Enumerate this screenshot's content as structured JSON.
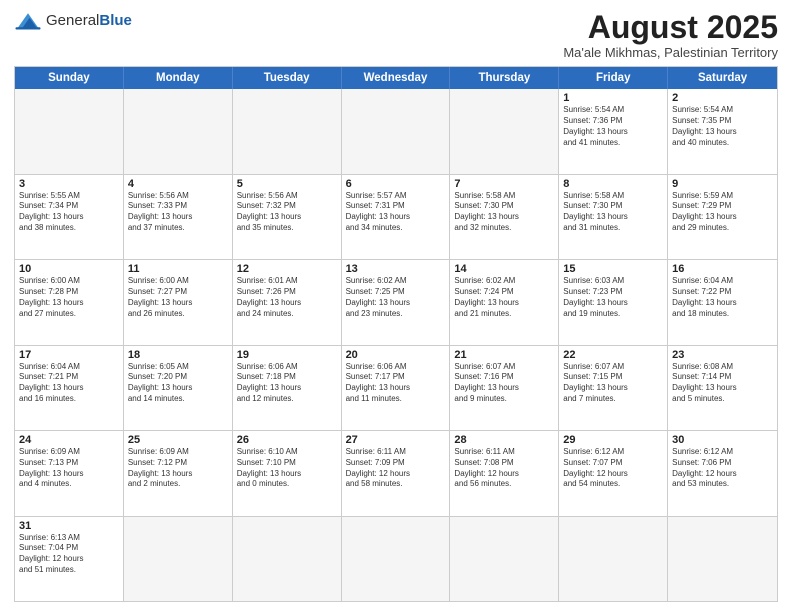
{
  "header": {
    "logo_general": "General",
    "logo_blue": "Blue",
    "title": "August 2025",
    "location": "Ma'ale Mikhmas, Palestinian Territory"
  },
  "calendar": {
    "days_of_week": [
      "Sunday",
      "Monday",
      "Tuesday",
      "Wednesday",
      "Thursday",
      "Friday",
      "Saturday"
    ],
    "rows": [
      [
        {
          "num": "",
          "info": ""
        },
        {
          "num": "",
          "info": ""
        },
        {
          "num": "",
          "info": ""
        },
        {
          "num": "",
          "info": ""
        },
        {
          "num": "",
          "info": ""
        },
        {
          "num": "1",
          "info": "Sunrise: 5:54 AM\nSunset: 7:36 PM\nDaylight: 13 hours\nand 41 minutes."
        },
        {
          "num": "2",
          "info": "Sunrise: 5:54 AM\nSunset: 7:35 PM\nDaylight: 13 hours\nand 40 minutes."
        }
      ],
      [
        {
          "num": "3",
          "info": "Sunrise: 5:55 AM\nSunset: 7:34 PM\nDaylight: 13 hours\nand 38 minutes."
        },
        {
          "num": "4",
          "info": "Sunrise: 5:56 AM\nSunset: 7:33 PM\nDaylight: 13 hours\nand 37 minutes."
        },
        {
          "num": "5",
          "info": "Sunrise: 5:56 AM\nSunset: 7:32 PM\nDaylight: 13 hours\nand 35 minutes."
        },
        {
          "num": "6",
          "info": "Sunrise: 5:57 AM\nSunset: 7:31 PM\nDaylight: 13 hours\nand 34 minutes."
        },
        {
          "num": "7",
          "info": "Sunrise: 5:58 AM\nSunset: 7:30 PM\nDaylight: 13 hours\nand 32 minutes."
        },
        {
          "num": "8",
          "info": "Sunrise: 5:58 AM\nSunset: 7:30 PM\nDaylight: 13 hours\nand 31 minutes."
        },
        {
          "num": "9",
          "info": "Sunrise: 5:59 AM\nSunset: 7:29 PM\nDaylight: 13 hours\nand 29 minutes."
        }
      ],
      [
        {
          "num": "10",
          "info": "Sunrise: 6:00 AM\nSunset: 7:28 PM\nDaylight: 13 hours\nand 27 minutes."
        },
        {
          "num": "11",
          "info": "Sunrise: 6:00 AM\nSunset: 7:27 PM\nDaylight: 13 hours\nand 26 minutes."
        },
        {
          "num": "12",
          "info": "Sunrise: 6:01 AM\nSunset: 7:26 PM\nDaylight: 13 hours\nand 24 minutes."
        },
        {
          "num": "13",
          "info": "Sunrise: 6:02 AM\nSunset: 7:25 PM\nDaylight: 13 hours\nand 23 minutes."
        },
        {
          "num": "14",
          "info": "Sunrise: 6:02 AM\nSunset: 7:24 PM\nDaylight: 13 hours\nand 21 minutes."
        },
        {
          "num": "15",
          "info": "Sunrise: 6:03 AM\nSunset: 7:23 PM\nDaylight: 13 hours\nand 19 minutes."
        },
        {
          "num": "16",
          "info": "Sunrise: 6:04 AM\nSunset: 7:22 PM\nDaylight: 13 hours\nand 18 minutes."
        }
      ],
      [
        {
          "num": "17",
          "info": "Sunrise: 6:04 AM\nSunset: 7:21 PM\nDaylight: 13 hours\nand 16 minutes."
        },
        {
          "num": "18",
          "info": "Sunrise: 6:05 AM\nSunset: 7:20 PM\nDaylight: 13 hours\nand 14 minutes."
        },
        {
          "num": "19",
          "info": "Sunrise: 6:06 AM\nSunset: 7:18 PM\nDaylight: 13 hours\nand 12 minutes."
        },
        {
          "num": "20",
          "info": "Sunrise: 6:06 AM\nSunset: 7:17 PM\nDaylight: 13 hours\nand 11 minutes."
        },
        {
          "num": "21",
          "info": "Sunrise: 6:07 AM\nSunset: 7:16 PM\nDaylight: 13 hours\nand 9 minutes."
        },
        {
          "num": "22",
          "info": "Sunrise: 6:07 AM\nSunset: 7:15 PM\nDaylight: 13 hours\nand 7 minutes."
        },
        {
          "num": "23",
          "info": "Sunrise: 6:08 AM\nSunset: 7:14 PM\nDaylight: 13 hours\nand 5 minutes."
        }
      ],
      [
        {
          "num": "24",
          "info": "Sunrise: 6:09 AM\nSunset: 7:13 PM\nDaylight: 13 hours\nand 4 minutes."
        },
        {
          "num": "25",
          "info": "Sunrise: 6:09 AM\nSunset: 7:12 PM\nDaylight: 13 hours\nand 2 minutes."
        },
        {
          "num": "26",
          "info": "Sunrise: 6:10 AM\nSunset: 7:10 PM\nDaylight: 13 hours\nand 0 minutes."
        },
        {
          "num": "27",
          "info": "Sunrise: 6:11 AM\nSunset: 7:09 PM\nDaylight: 12 hours\nand 58 minutes."
        },
        {
          "num": "28",
          "info": "Sunrise: 6:11 AM\nSunset: 7:08 PM\nDaylight: 12 hours\nand 56 minutes."
        },
        {
          "num": "29",
          "info": "Sunrise: 6:12 AM\nSunset: 7:07 PM\nDaylight: 12 hours\nand 54 minutes."
        },
        {
          "num": "30",
          "info": "Sunrise: 6:12 AM\nSunset: 7:06 PM\nDaylight: 12 hours\nand 53 minutes."
        }
      ],
      [
        {
          "num": "31",
          "info": "Sunrise: 6:13 AM\nSunset: 7:04 PM\nDaylight: 12 hours\nand 51 minutes."
        },
        {
          "num": "",
          "info": ""
        },
        {
          "num": "",
          "info": ""
        },
        {
          "num": "",
          "info": ""
        },
        {
          "num": "",
          "info": ""
        },
        {
          "num": "",
          "info": ""
        },
        {
          "num": "",
          "info": ""
        }
      ]
    ]
  }
}
